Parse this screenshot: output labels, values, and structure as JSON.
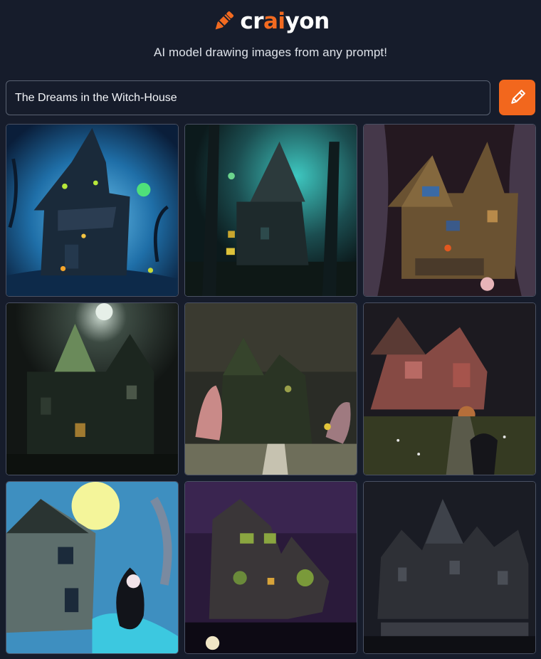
{
  "header": {
    "brand_prefix": "cr",
    "brand_accent": "ai",
    "brand_suffix": "yon",
    "logo_icon": "crayon-icon",
    "tagline": "AI model drawing images from any prompt!"
  },
  "search": {
    "value": "The Dreams in the Witch-House",
    "button_icon": "pencil-icon"
  },
  "colors": {
    "background": "#161c2b",
    "accent": "#f2671d",
    "input_border": "#5a6272"
  },
  "results": [
    {
      "name": "generated-image-1",
      "icon": "haunted-house-image"
    },
    {
      "name": "generated-image-2",
      "icon": "haunted-house-image"
    },
    {
      "name": "generated-image-3",
      "icon": "haunted-house-image"
    },
    {
      "name": "generated-image-4",
      "icon": "haunted-house-image"
    },
    {
      "name": "generated-image-5",
      "icon": "haunted-house-image"
    },
    {
      "name": "generated-image-6",
      "icon": "haunted-house-image"
    },
    {
      "name": "generated-image-7",
      "icon": "haunted-house-image"
    },
    {
      "name": "generated-image-8",
      "icon": "haunted-house-image"
    },
    {
      "name": "generated-image-9",
      "icon": "haunted-house-image"
    }
  ]
}
